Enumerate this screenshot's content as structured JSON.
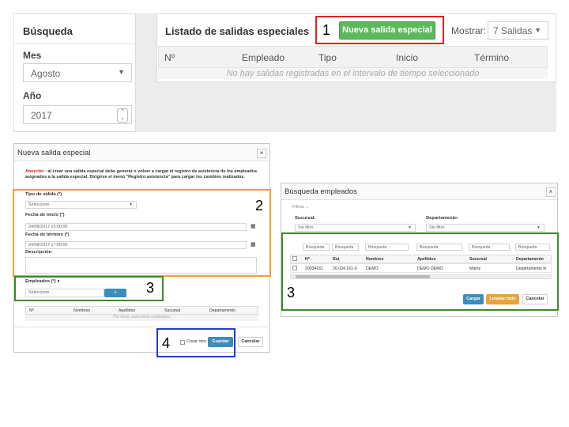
{
  "top": {
    "search_panel": {
      "title": "Búsqueda",
      "month_label": "Mes",
      "month_value": "Agosto",
      "year_label": "Año",
      "year_value": "2017"
    },
    "list_panel": {
      "title": "Listado de salidas especiales",
      "new_button": "Nueva salida especial",
      "show_label": "Mostrar:",
      "show_value": "7 Salidas",
      "columns": [
        "Nº",
        "Empleado",
        "Tipo",
        "Inicio",
        "Término"
      ],
      "empty_message": "No hay salidas registradas en el intervalo de tiempo seleccionado"
    },
    "callout": "1"
  },
  "modal_new": {
    "title": "Nueva salida especial",
    "close": "×",
    "warning_prefix": "Atención :",
    "warning_text": " al crear una salida especial debe generar o volver a cargar el registro de asistencia de los empleados asignados a la salida especial. Dirigirse el menú \"Registro asistencia\" para cargar los cambios realizados.",
    "type_label": "Tipo de salida (*)",
    "type_value": "Seleccione",
    "start_label": "Fecha de inicio (*)",
    "start_value": "24/08/2017 16:00:00",
    "end_label": "Fecha de término (*)",
    "end_value": "24/08/2017 17:00:00",
    "desc_label": "Descripción",
    "employees_label": "Empleados (*)",
    "employees_value": "Seleccione",
    "add_button": "+",
    "columns": [
      "Nº",
      "Nombres",
      "Apellidos",
      "Sucursal",
      "Departamento"
    ],
    "empty_message": "Por favor, seleccione empleados",
    "create_another": "Crear otro",
    "save_button": "Guardar",
    "cancel_button": "Cancelar",
    "callout_2": "2",
    "callout_3": "3",
    "callout_4": "4"
  },
  "modal_search": {
    "title": "Búsqueda empleados",
    "close": "×",
    "filters_label": "Filtros",
    "branch_label": "Sucursal:",
    "branch_value": "Sin filtro",
    "dept_label": "Departamento:",
    "dept_value": "Sin filtro",
    "search_placeholders": [
      "Búsqueda",
      "Búsqueda",
      "Búsqueda",
      "Búsqueda",
      "Búsqueda",
      "Búsqueda"
    ],
    "columns": [
      "Nº",
      "Rut",
      "Nombres",
      "Apellidos",
      "Sucursal",
      "Departamento"
    ],
    "rows": [
      [
        "20034161",
        "20.034.161-9",
        "DEMO",
        "DEMO DEMO",
        "Matriz",
        "Departamento in"
      ]
    ],
    "load_button": "Cargar",
    "clear_button": "Limpiar todo",
    "cancel_button": "Cancelar",
    "callout_3": "3"
  },
  "colors": {
    "green_button": "#5cb85c",
    "blue_button": "#3c8dbc",
    "orange_button": "#e8a33c",
    "red_box": "#e0201c",
    "orange_box": "#f0a030",
    "green_box": "#3f8a2a",
    "blue_box": "#1f3fd0",
    "warning_red": "#d0201c"
  }
}
